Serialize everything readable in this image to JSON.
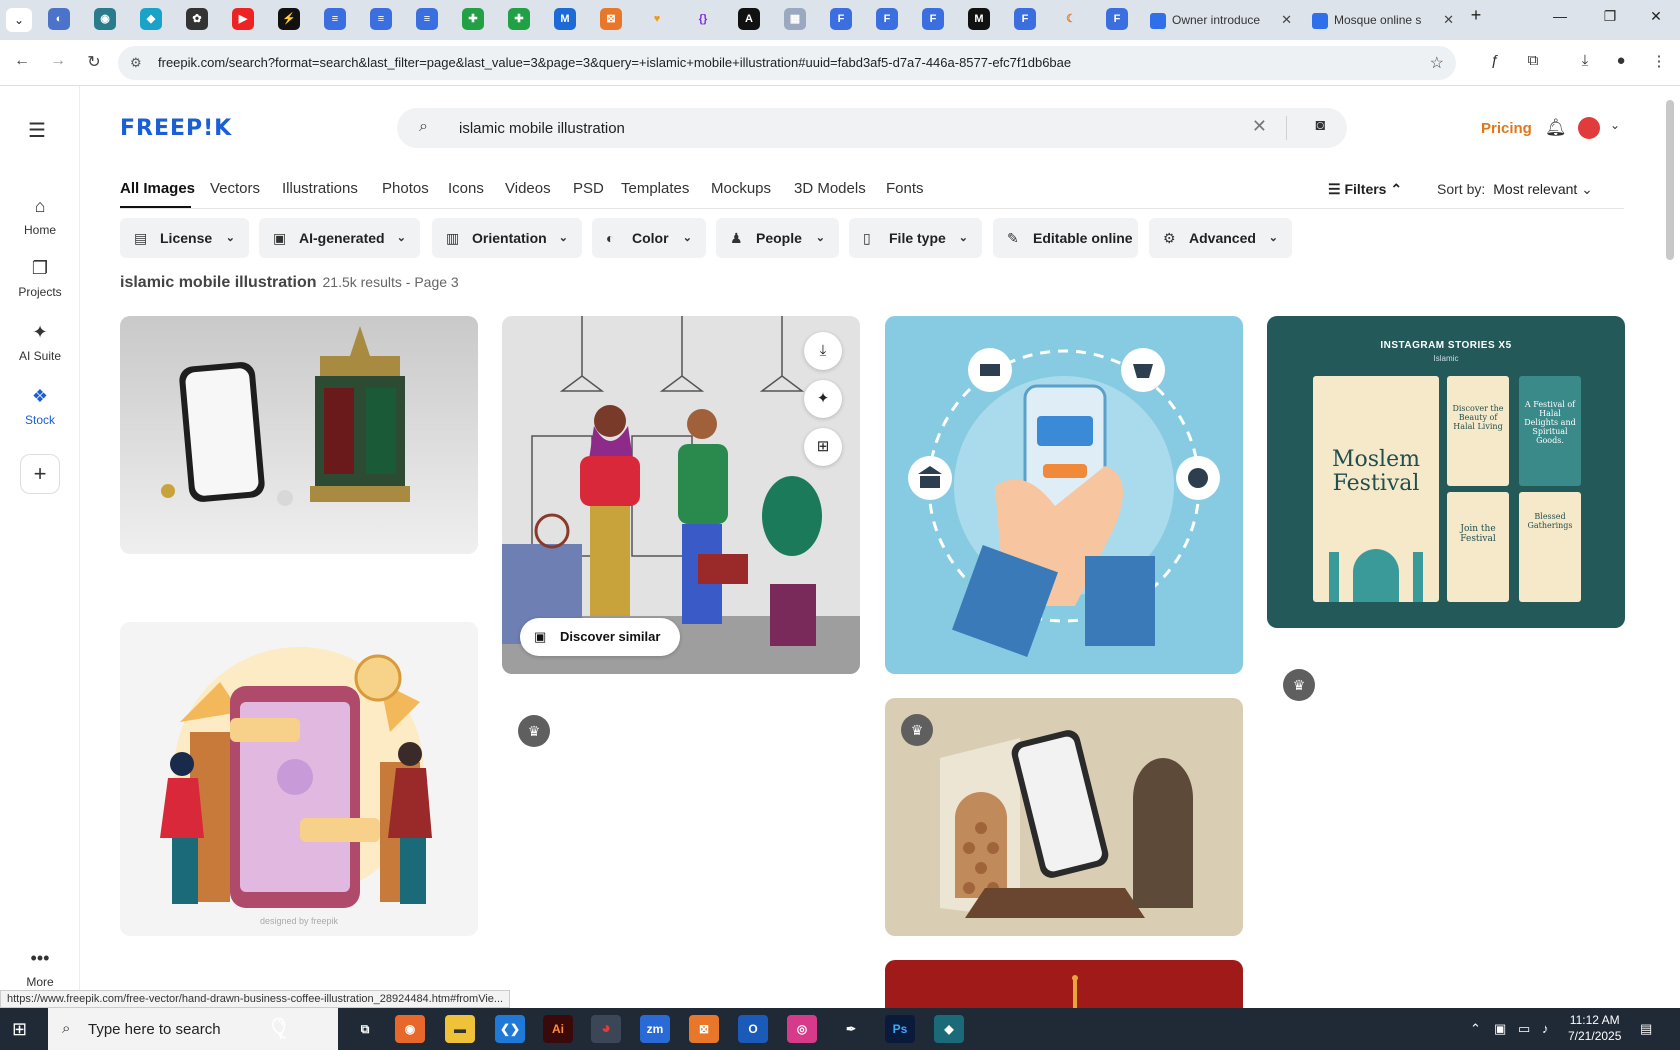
{
  "browser": {
    "tabs": [
      {
        "title": "Owner introduce",
        "active": false
      },
      {
        "title": "Mosque online s",
        "active": false
      }
    ],
    "url": "freepik.com/search?format=search&last_filter=page&last_value=3&page=3&query=+islamic+mobile+illustration#uuid=fabd3af5-d7a7-446a-8577-efc7f1db6bae",
    "status_url": "https://www.freepik.com/free-vector/hand-drawn-business-coffee-illustration_28924484.htm#fromVie..."
  },
  "sidebar": {
    "items": [
      {
        "label": "Home"
      },
      {
        "label": "Projects"
      },
      {
        "label": "AI Suite"
      },
      {
        "label": "Stock"
      }
    ],
    "more_label": "More"
  },
  "header": {
    "logo": "FREEP!K",
    "search_value": "islamic mobile illustration",
    "pricing": "Pricing"
  },
  "categories": [
    "All Images",
    "Vectors",
    "Illustrations",
    "Photos",
    "Icons",
    "Videos",
    "PSD",
    "Templates",
    "Mockups",
    "3D Models",
    "Fonts"
  ],
  "toolbar": {
    "filters": "Filters",
    "sort_label": "Sort by:",
    "sort_value": "Most relevant"
  },
  "chips": [
    "License",
    "AI-generated",
    "Orientation",
    "Color",
    "People",
    "File type",
    "Editable online",
    "Advanced"
  ],
  "results": {
    "query": "islamic mobile illustration",
    "count": "21.5k results",
    "page": " - Page 3"
  },
  "cards": {
    "discover_label": "Discover similar",
    "story_title": "INSTAGRAM STORIES X5",
    "story_sub": "Islamic",
    "story_main": "Moslem Festival",
    "story_2": "Discover the Beauty of Halal Living",
    "story_3": "A Festival of Halal Delights and Spiritual Goods.",
    "story_4": "Join the Festival",
    "story_5": "Blessed Gatherings",
    "watermark": "designed by freepik"
  },
  "taskbar": {
    "search_placeholder": "Type here to search",
    "time": "11:12 AM",
    "date": "7/21/2025"
  }
}
